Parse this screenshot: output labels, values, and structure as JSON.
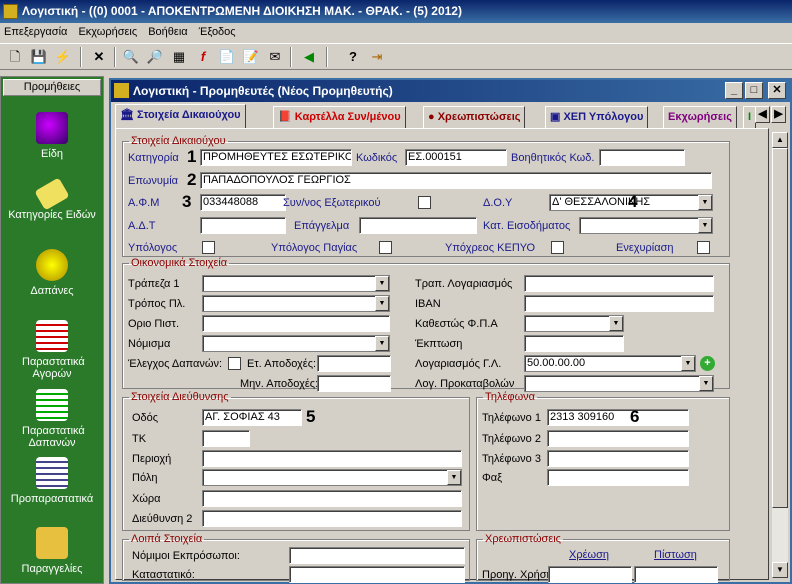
{
  "app": {
    "title": "Λογιστική - ((0) 0001 - ΑΠΟΚΕΝΤΡΩΜΕΝΗ ΔΙΟΙΚΗΣΗ  ΜΑΚ. - ΘΡΑΚ. - (5) 2012)"
  },
  "menu": [
    "Επεξεργασία",
    "Εκχωρήσεις",
    "Βοήθεια",
    "Έξοδος"
  ],
  "sidebar": {
    "header": "Προμήθειες",
    "items": [
      {
        "label": "Είδη",
        "icon": "items-icon"
      },
      {
        "label": "Κατηγορίες Ειδών",
        "icon": "tag-icon"
      },
      {
        "label": "Δαπάνες",
        "icon": "bulb-icon"
      },
      {
        "label": "Παραστατικά Αγορών",
        "icon": "purchase-docs-icon"
      },
      {
        "label": "Παραστατικά Δαπανών",
        "icon": "expense-docs-icon"
      },
      {
        "label": "Προπαραστατικά",
        "icon": "predocs-icon"
      },
      {
        "label": "Παραγγελίες",
        "icon": "orders-icon"
      }
    ]
  },
  "window": {
    "title": "Λογιστική - Προμηθευτές  (Νέος Προμηθευτής)"
  },
  "tabs": [
    "Στοιχεία Δικαιούχου",
    "Καρτέλλα Συν/μένου",
    "Χρεωπιστώσεις",
    "ΧΕΠ Υπόλογου",
    "Εκχωρήσεις",
    "Ι"
  ],
  "sections": {
    "beneficiary": {
      "legend": "Στοιχεία Δικαιούχου",
      "category_label": "Κατηγορία",
      "category_value": "ΠΡΟΜΗΘΕΥΤΕΣ ΕΣΩΤΕΡΙΚΟΥ",
      "code_label": "Κωδικός",
      "code_value": "ΕΣ.000151",
      "aux_code_label": "Βοηθητικός Κωδ.",
      "aux_code_value": "",
      "name_label": "Επωνυμία",
      "name_value": "ΠΑΠΑΔΟΠΟΥΛΟΣ ΓΕΩΡΓΙΟΣ",
      "afm_label": "Α.Φ.Μ",
      "afm_value": "033448088",
      "partner_label": "Συν/νος Εξωτερικού",
      "doy_label": "Δ.Ο.Υ",
      "doy_value": "Δ' ΘΕΣΣΑΛΟΝΙΚΗΣ",
      "adt_label": "Α.Δ.Τ",
      "profession_label": "Επάγγελμα",
      "income_cat_label": "Κατ. Εισοδήματος",
      "accountable_label": "Υπόλογος",
      "assets_label": "Υπόλογος Παγίας",
      "kepyo_label": "Υπόχρεος ΚΕΠΥΟ",
      "pledge_label": "Ενεχυρίαση"
    },
    "financial": {
      "legend": "Οικονομικά Στοιχεία",
      "bank_label": "Τράπεζα 1",
      "bank_account_label": "Τραπ. Λογαριασμός",
      "payment_label": "Τρόπος Πλ.",
      "iban_label": "IBAN",
      "credit_label": "Οριο Πιστ.",
      "vat_label": "Καθεστώς Φ.Π.Α",
      "currency_label": "Νόμισμα",
      "discount_label": "Έκπτωση",
      "expense_check_label": "Έλεγχος Δαπανών:",
      "annual_label": "Ετ. Αποδοχές:",
      "ledger_label": "Λογαριασμός Γ.Λ.",
      "ledger_value": "50.00.00.00",
      "monthly_label": "Μην. Αποδοχές:",
      "advance_label": "Λογ. Προκαταβολών"
    },
    "address": {
      "legend": "Στοιχεία Διεύθυνσης",
      "street_label": "Οδός",
      "street_value": "ΑΓ. ΣΟΦΙΑΣ 43",
      "zip_label": "ΤΚ",
      "area_label": "Περιοχή",
      "city_label": "Πόλη",
      "country_label": "Χώρα",
      "address2_label": "Διεύθυνση 2"
    },
    "phones": {
      "legend": "Τηλέφωνα",
      "phone1_label": "Τηλέφωνο 1",
      "phone1_value": "2313 309160",
      "phone2_label": "Τηλέφωνο 2",
      "phone3_label": "Τηλέφωνο 3",
      "fax_label": "Φαξ"
    },
    "other": {
      "legend": "Λοιπά Στοιχεία",
      "legal_rep_label": "Νόμιμοι Εκπρόσωποι:",
      "statute_label": "Καταστατικό:"
    },
    "debits": {
      "legend": "Χρεωπιστώσεις",
      "debit_label": "Χρέωση",
      "credit_label": "Πίστωση",
      "prev_year_label": "Προηγ. Χρήση"
    }
  },
  "markers": [
    "1",
    "2",
    "3",
    "4",
    "5",
    "6"
  ]
}
